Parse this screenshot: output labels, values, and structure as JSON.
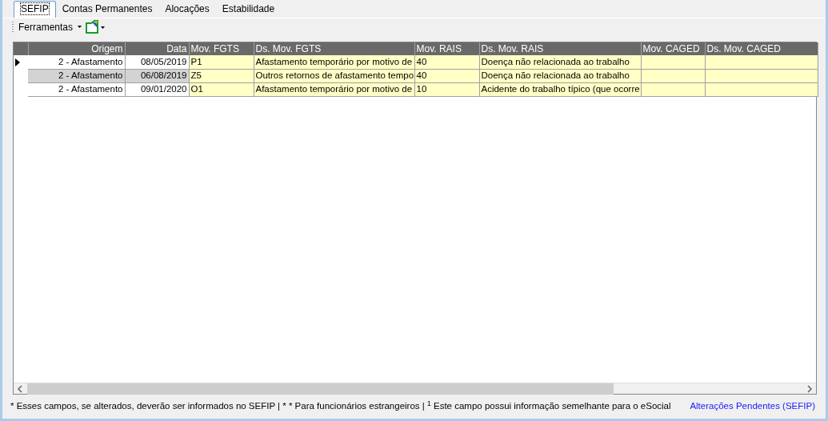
{
  "tabs": [
    {
      "label": "SEFIP",
      "selected": true
    },
    {
      "label": "Contas Permanentes",
      "selected": false
    },
    {
      "label": "Alocações",
      "selected": false
    },
    {
      "label": "Estabilidade",
      "selected": false
    }
  ],
  "toolbar": {
    "menu": "Ferramentas"
  },
  "table": {
    "columns": [
      "Origem",
      "Data",
      "Mov. FGTS",
      "Ds. Mov. FGTS",
      "Mov. RAIS",
      "Ds. Mov. RAIS",
      "Mov. CAGED",
      "Ds. Mov. CAGED"
    ],
    "rows": [
      {
        "current": true,
        "cells": [
          "2 - Afastamento",
          "08/05/2019",
          "P1",
          "Afastamento temporário por motivo de",
          "40",
          "Doença não relacionada ao trabalho",
          "",
          ""
        ]
      },
      {
        "current": false,
        "cells": [
          "2 - Afastamento",
          "06/08/2019",
          "Z5",
          "Outros retornos de afastamento tempo",
          "40",
          "Doença não relacionada ao trabalho",
          "",
          ""
        ]
      },
      {
        "current": false,
        "cells": [
          "2 - Afastamento",
          "09/01/2020",
          "O1",
          "Afastamento temporário por motivo de",
          "10",
          "Acidente do trabalho típico (que ocorre",
          "",
          ""
        ]
      }
    ]
  },
  "footer": {
    "note": "* Esses campos, se alterados, deverão ser informados no SEFIP | * * Para funcionários estrangeiros |  $^{1}$ Este campo possui informação semelhante para o eSocial",
    "link": "Alterações Pendentes (SEFIP)"
  }
}
